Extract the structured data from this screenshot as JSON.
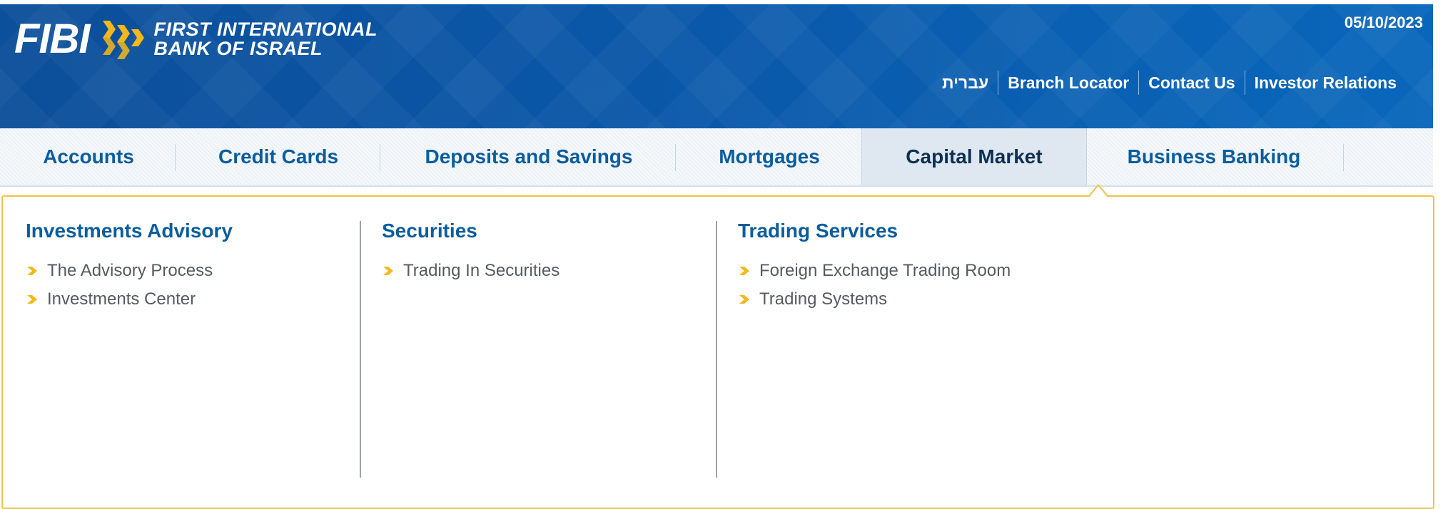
{
  "header": {
    "logo_text": "FIBI",
    "bank_name_line1": "FIRST INTERNATIONAL",
    "bank_name_line2": "BANK OF ISRAEL",
    "date": "05/10/2023",
    "links": [
      "עברית",
      "Branch Locator",
      "Contact Us",
      "Investor Relations"
    ]
  },
  "nav": {
    "items": [
      "Accounts",
      "Credit Cards",
      "Deposits and Savings",
      "Mortgages",
      "Capital Market",
      "Business Banking"
    ],
    "active": "Capital Market"
  },
  "mega_menu": {
    "columns": [
      {
        "title": "Investments Advisory",
        "links": [
          "The Advisory Process",
          "Investments Center"
        ]
      },
      {
        "title": "Securities",
        "links": [
          "Trading In Securities"
        ]
      },
      {
        "title": "Trading Services",
        "links": [
          "Foreign Exchange Trading Room",
          "Trading Systems"
        ]
      }
    ]
  },
  "colors": {
    "header_blue": "#0a57a8",
    "nav_text": "#0b5d9c",
    "active_text": "#0d2f52",
    "accent_yellow": "#f0c24a",
    "link_text": "#555b61"
  },
  "icons": {
    "bullet": "yellow-chevron-arrow",
    "logo_mark": "triple-chevron-logo"
  }
}
